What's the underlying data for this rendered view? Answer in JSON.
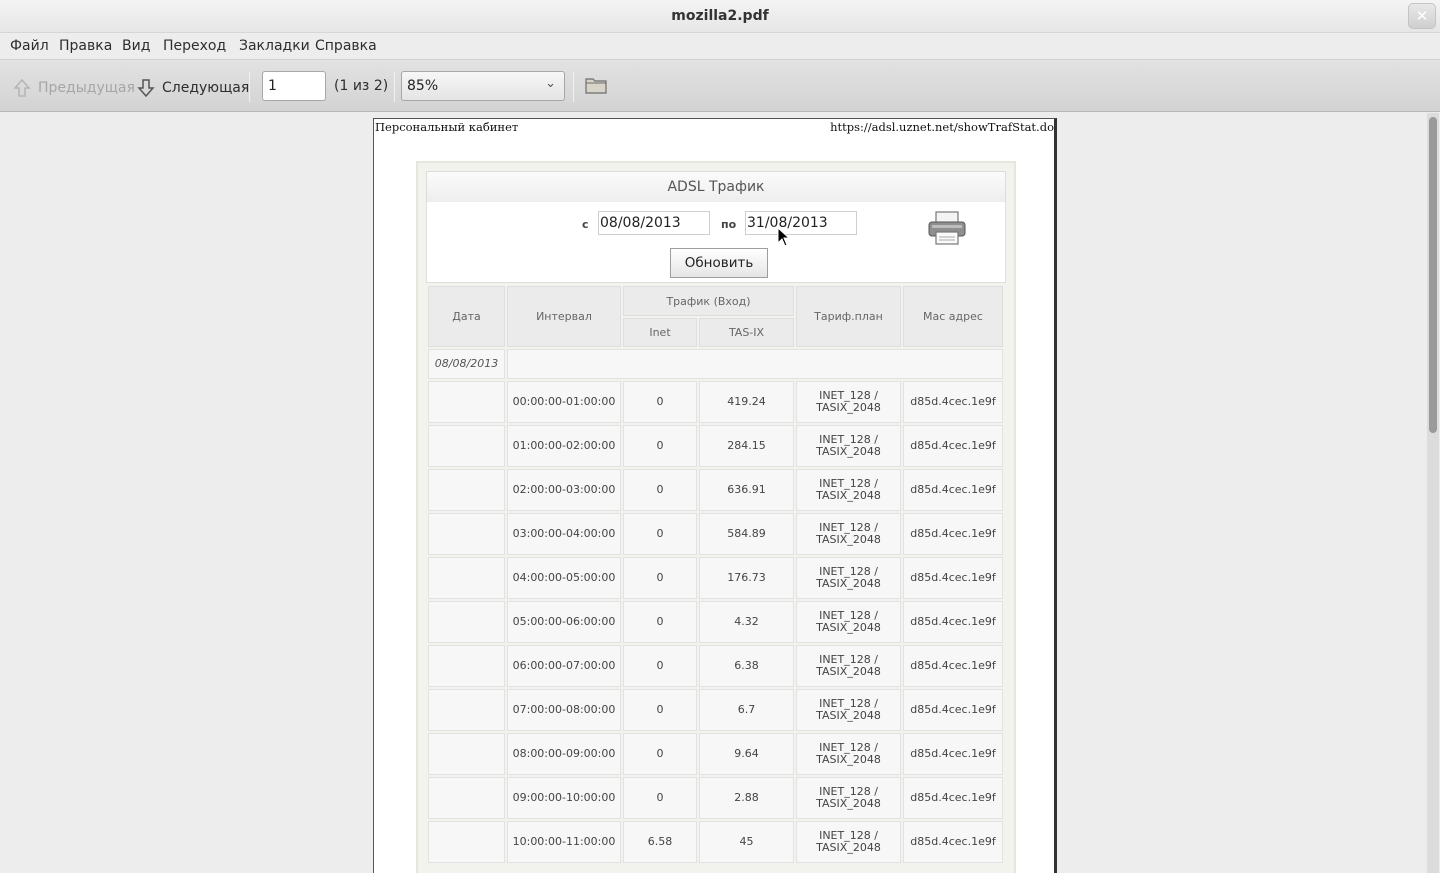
{
  "window": {
    "title": "mozilla2.pdf",
    "close_glyph": "✕"
  },
  "menu": [
    "Файл",
    "Правка",
    "Вид",
    "Переход",
    "Закладки",
    "Справка"
  ],
  "toolbar": {
    "prev_label": "Предыдущая",
    "next_label": "Следующая",
    "page_value": "1",
    "page_count": "(1 из 2)",
    "zoom_value": "85%",
    "open_icon": "folder-icon"
  },
  "pdf": {
    "header_left": "Персональный кабинет",
    "header_right": "https://adsl.uznet.net/showTrafStat.do",
    "panel": {
      "title": "ADSL Трафик",
      "from_label": "с",
      "from_value": "08/08/2013",
      "to_label": "по",
      "to_value": "31/08/2013",
      "refresh_label": "Обновить",
      "print_icon": "printer-icon"
    },
    "table": {
      "headers": {
        "date": "Дата",
        "interval": "Интервал",
        "traffic": "Трафик (Вход)",
        "inet": "Inet",
        "tasix": "TAS-IX",
        "tariff": "Тариф.план",
        "mac": "Мас адрес"
      },
      "group_date": "08/08/2013",
      "rows": [
        {
          "interval": "00:00:00-01:00:00",
          "inet": "0",
          "tasix": "419.24",
          "tariff1": "INET_128 /",
          "tariff2": "TASIX_2048",
          "mac": "d85d.4cec.1e9f"
        },
        {
          "interval": "01:00:00-02:00:00",
          "inet": "0",
          "tasix": "284.15",
          "tariff1": "INET_128 /",
          "tariff2": "TASIX_2048",
          "mac": "d85d.4cec.1e9f"
        },
        {
          "interval": "02:00:00-03:00:00",
          "inet": "0",
          "tasix": "636.91",
          "tariff1": "INET_128 /",
          "tariff2": "TASIX_2048",
          "mac": "d85d.4cec.1e9f"
        },
        {
          "interval": "03:00:00-04:00:00",
          "inet": "0",
          "tasix": "584.89",
          "tariff1": "INET_128 /",
          "tariff2": "TASIX_2048",
          "mac": "d85d.4cec.1e9f"
        },
        {
          "interval": "04:00:00-05:00:00",
          "inet": "0",
          "tasix": "176.73",
          "tariff1": "INET_128 /",
          "tariff2": "TASIX_2048",
          "mac": "d85d.4cec.1e9f"
        },
        {
          "interval": "05:00:00-06:00:00",
          "inet": "0",
          "tasix": "4.32",
          "tariff1": "INET_128 /",
          "tariff2": "TASIX_2048",
          "mac": "d85d.4cec.1e9f"
        },
        {
          "interval": "06:00:00-07:00:00",
          "inet": "0",
          "tasix": "6.38",
          "tariff1": "INET_128 /",
          "tariff2": "TASIX_2048",
          "mac": "d85d.4cec.1e9f"
        },
        {
          "interval": "07:00:00-08:00:00",
          "inet": "0",
          "tasix": "6.7",
          "tariff1": "INET_128 /",
          "tariff2": "TASIX_2048",
          "mac": "d85d.4cec.1e9f"
        },
        {
          "interval": "08:00:00-09:00:00",
          "inet": "0",
          "tasix": "9.64",
          "tariff1": "INET_128 /",
          "tariff2": "TASIX_2048",
          "mac": "d85d.4cec.1e9f"
        },
        {
          "interval": "09:00:00-10:00:00",
          "inet": "0",
          "tasix": "2.88",
          "tariff1": "INET_128 /",
          "tariff2": "TASIX_2048",
          "mac": "d85d.4cec.1e9f"
        },
        {
          "interval": "10:00:00-11:00:00",
          "inet": "6.58",
          "tasix": "45",
          "tariff1": "INET_128 /",
          "tariff2": "TASIX_2048",
          "mac": "d85d.4cec.1e9f"
        }
      ]
    }
  }
}
